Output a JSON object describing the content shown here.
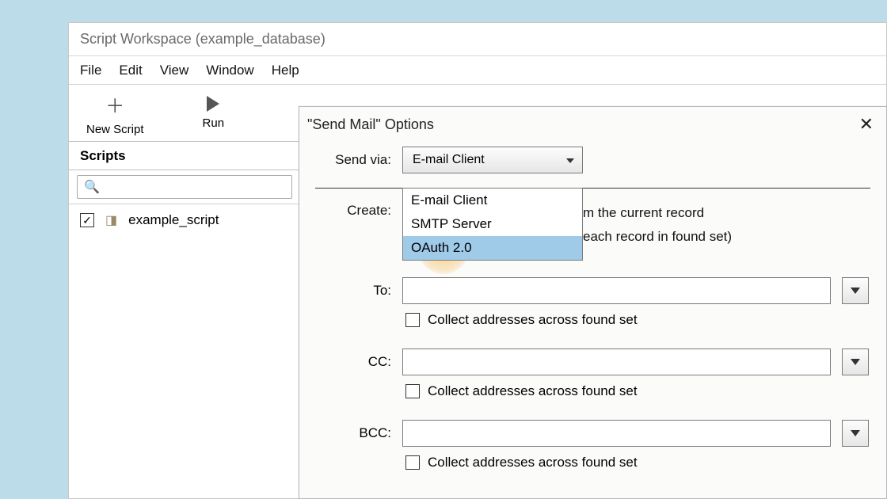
{
  "window": {
    "title": "Script Workspace (example_database)"
  },
  "menubar": {
    "file": "File",
    "edit": "Edit",
    "view": "View",
    "window": "Window",
    "help": "Help"
  },
  "toolbar": {
    "new_script": "New Script",
    "run": "Run"
  },
  "sidebar": {
    "title": "Scripts",
    "search_placeholder": "",
    "items": [
      {
        "checked": true,
        "name": "example_script"
      }
    ]
  },
  "dialog": {
    "title": "\"Send Mail\" Options",
    "send_via_label": "Send via:",
    "send_via_value": "E-mail Client",
    "send_via_options": [
      "E-mail Client",
      "SMTP Server",
      "OAuth 2.0"
    ],
    "send_via_highlighted_index": 2,
    "create_label": "Create:",
    "create_line1_suffix": "m the current record",
    "create_line2_suffix": "each record in found set)",
    "to_label": "To:",
    "cc_label": "CC:",
    "bcc_label": "BCC:",
    "collect_label": "Collect addresses across found set"
  }
}
